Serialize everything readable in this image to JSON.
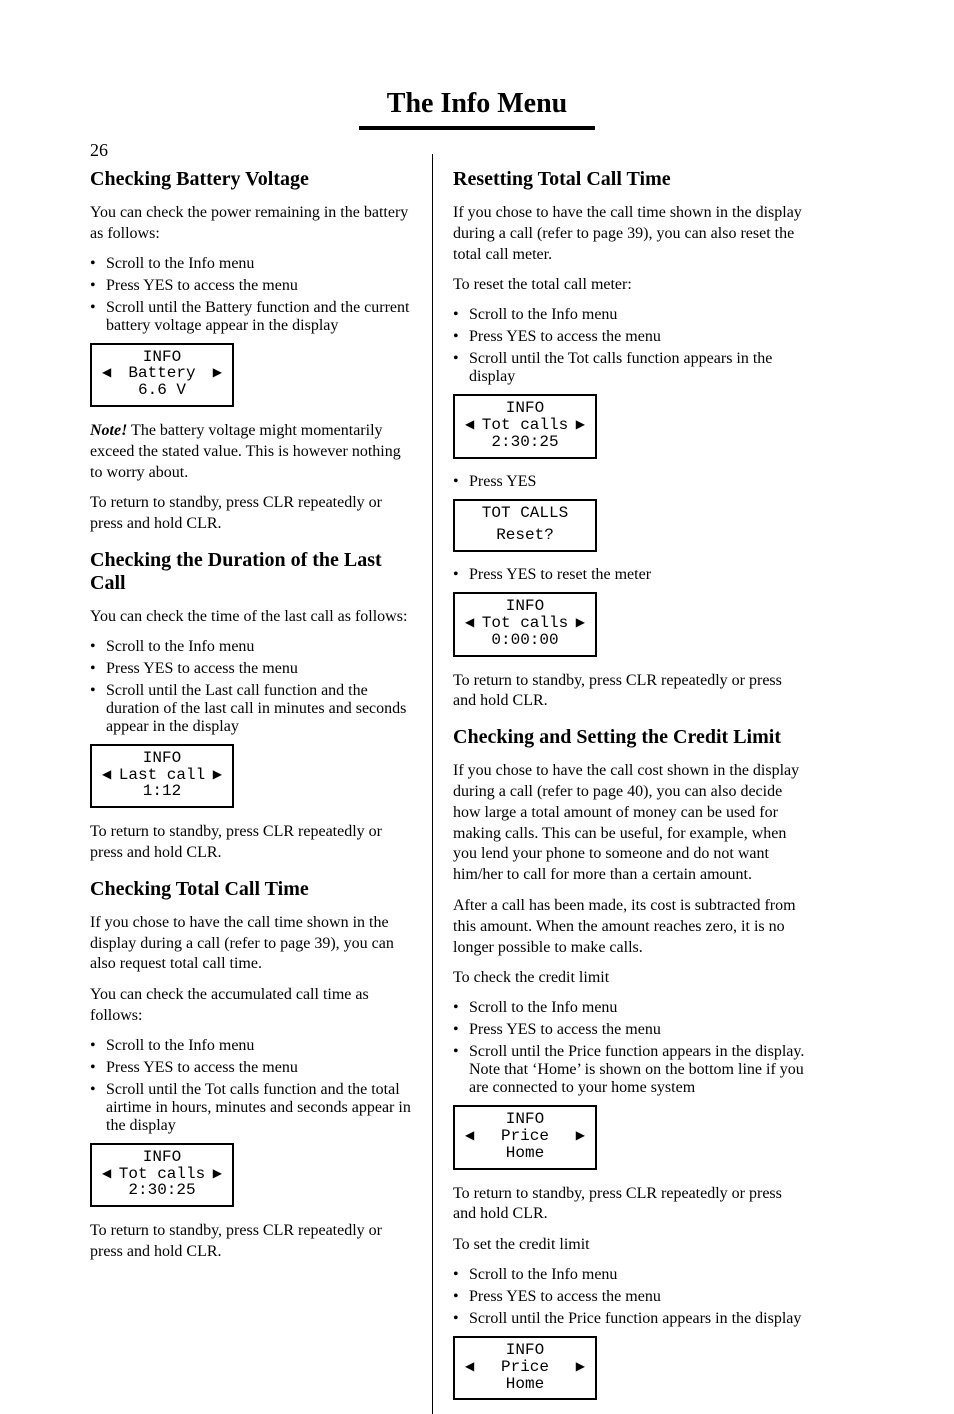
{
  "page_number": "26",
  "title": "The Info Menu",
  "left": {
    "battery": {
      "heading": "Checking Battery Voltage",
      "intro": "You can check the power remaining in the battery as follows:",
      "steps": [
        "Scroll to the Info menu",
        "Press YES to access the menu",
        "Scroll until the Battery function and the current battery voltage appear in the display"
      ],
      "note_label": "Note!",
      "note_text": " The battery voltage might momentarily exceed the stated value. This is however nothing to worry about.",
      "outro": "To return to standby, press CLR repeatedly or press and hold CLR.",
      "lcd": {
        "title": "INFO",
        "mid": "Battery",
        "value": "6.6 V"
      }
    },
    "last_call": {
      "heading": "Checking the Duration of the Last Call",
      "intro": "You can check the time of the last call as follows:",
      "steps": [
        "Scroll to the Info menu",
        "Press YES to access the menu",
        "Scroll until the Last call function and the duration of the last call in minutes and seconds appear in the display"
      ],
      "outro": "To return to standby, press CLR repeatedly or press and hold CLR.",
      "lcd": {
        "title": "INFO",
        "mid": "Last call",
        "value": "1:12"
      }
    },
    "tot_calls": {
      "heading": "Checking Total Call Time",
      "intro_a": "If you chose to have the call time shown in the display during a call (refer to page 39), you can also request total call time.",
      "intro_b": "You can check the accumulated call time as follows:",
      "steps": [
        "Scroll to the Info menu",
        "Press YES to access the menu",
        "Scroll until the Tot calls function and the total airtime in hours, minutes and seconds appear in the display"
      ],
      "outro": "To return to standby, press CLR repeatedly or press and hold CLR.",
      "lcd": {
        "title": "INFO",
        "mid": "Tot calls",
        "value": "2:30:25"
      }
    }
  },
  "right": {
    "reset": {
      "heading": "Resetting Total Call Time",
      "intro_a": "If you chose to have the call time shown in the display during a call (refer to page 39), you can also reset the total call meter.",
      "intro_b": "To reset the total call meter:",
      "steps_a": [
        "Scroll to the Info menu",
        "Press YES to access the menu",
        "Scroll until the Tot calls function appears in the display"
      ],
      "lcd1": {
        "title": "INFO",
        "mid": "Tot calls",
        "value": "2:30:25"
      },
      "steps_b": [
        "Press YES"
      ],
      "lcd2": {
        "title": "TOT CALLS",
        "value": "Reset?"
      },
      "steps_c": [
        "Press YES to reset the meter"
      ],
      "lcd3": {
        "title": "INFO",
        "mid": "Tot calls",
        "value": "0:00:00"
      },
      "outro": "To return to standby, press CLR repeatedly or press and hold CLR."
    },
    "credit": {
      "heading": "Checking and Setting the Credit Limit",
      "intro_a": "If you chose to have the call cost shown in the display during a call (refer to page 40), you can also decide how large a total amount of money can be used for making calls. This can be useful, for example, when you lend your phone to someone and do not want him/her to call for more than a certain amount.",
      "intro_b": "After a call has been made, its cost is subtracted from this amount. When the amount reaches zero, it is no longer possible to make calls.",
      "check_heading": "To check the credit limit",
      "check_steps": [
        "Scroll to the Info menu",
        "Press YES to access the menu",
        "Scroll until the Price function appears in the display. Note that ‘Home’ is shown on the bottom line if you are connected to your home system"
      ],
      "lcd1": {
        "title": "INFO",
        "mid": "Price",
        "value": "Home"
      },
      "outro1": "To return to standby, press CLR repeatedly or press and hold CLR.",
      "set_heading": "To set the credit limit",
      "set_steps": [
        "Scroll to the Info menu",
        "Press YES to access the menu",
        "Scroll until the Price function appears in the display"
      ],
      "lcd2": {
        "title": "INFO",
        "mid": "Price",
        "value": "Home"
      }
    }
  }
}
